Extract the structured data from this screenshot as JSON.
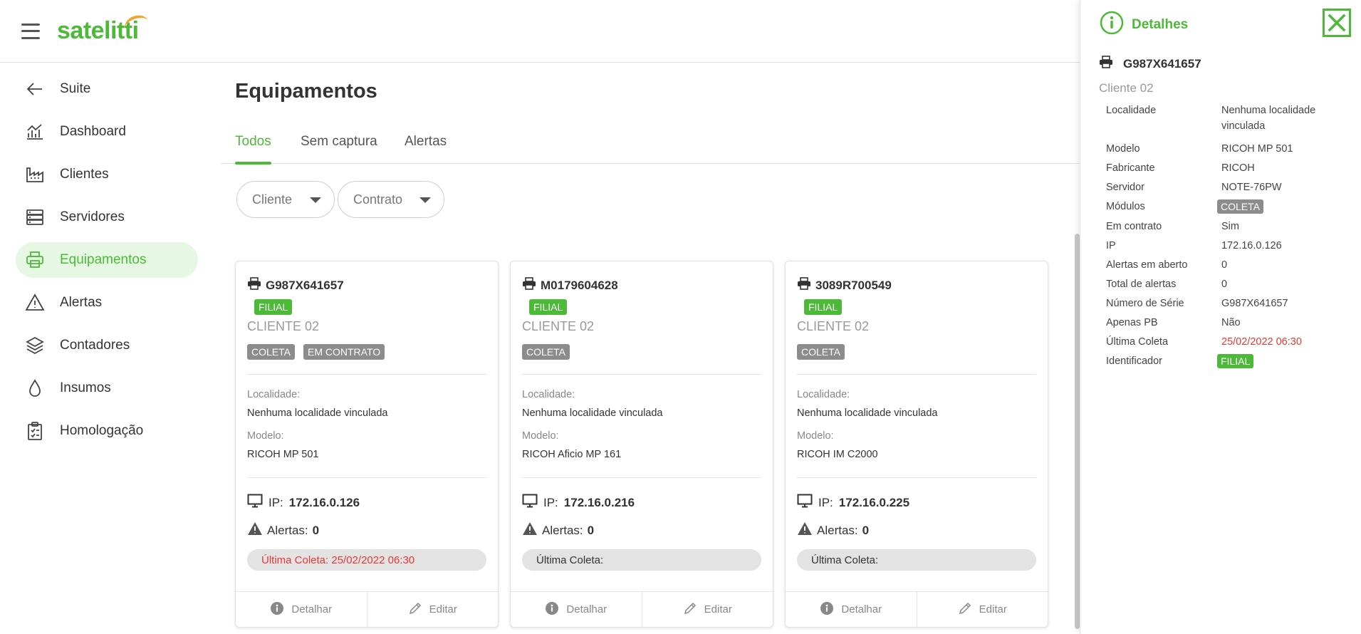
{
  "header": {
    "logo": "satelitti"
  },
  "sidebar": {
    "items": [
      {
        "label": "Suite",
        "icon": "arrow-left-icon",
        "active": false
      },
      {
        "label": "Dashboard",
        "icon": "chart-icon",
        "active": false
      },
      {
        "label": "Clientes",
        "icon": "factory-icon",
        "active": false
      },
      {
        "label": "Servidores",
        "icon": "server-icon",
        "active": false
      },
      {
        "label": "Equipamentos",
        "icon": "printer-icon",
        "active": true
      },
      {
        "label": "Alertas",
        "icon": "warning-icon",
        "active": false
      },
      {
        "label": "Contadores",
        "icon": "layers-icon",
        "active": false
      },
      {
        "label": "Insumos",
        "icon": "drop-icon",
        "active": false
      },
      {
        "label": "Homologação",
        "icon": "clipboard-icon",
        "active": false
      }
    ]
  },
  "main": {
    "title": "Equipamentos",
    "tabs": [
      {
        "label": "Todos",
        "active": true
      },
      {
        "label": "Sem captura",
        "active": false
      },
      {
        "label": "Alertas",
        "active": false
      }
    ],
    "filters": [
      {
        "label": "Cliente"
      },
      {
        "label": "Contrato"
      }
    ]
  },
  "cards": [
    {
      "serial": "G987X641657",
      "identifier": "FILIAL",
      "client": "CLIENTE 02",
      "tags": [
        "COLETA",
        "EM CONTRATO"
      ],
      "location_label": "Localidade:",
      "location": "Nenhuma localidade vinculada",
      "model_label": "Modelo:",
      "model": "RICOH MP 501",
      "ip_label": "IP:",
      "ip": "172.16.0.126",
      "alerts_label": "Alertas:",
      "alerts": "0",
      "last_capture": "Última Coleta: 25/02/2022 06:30",
      "last_capture_highlight": true,
      "detail_label": "Detalhar",
      "edit_label": "Editar"
    },
    {
      "serial": "M0179604628",
      "identifier": "FILIAL",
      "client": "CLIENTE 02",
      "tags": [
        "COLETA"
      ],
      "location_label": "Localidade:",
      "location": "Nenhuma localidade vinculada",
      "model_label": "Modelo:",
      "model": "RICOH Aficio MP 161",
      "ip_label": "IP:",
      "ip": "172.16.0.216",
      "alerts_label": "Alertas:",
      "alerts": "0",
      "last_capture": "Última Coleta:",
      "last_capture_highlight": false,
      "detail_label": "Detalhar",
      "edit_label": "Editar"
    },
    {
      "serial": "3089R700549",
      "identifier": "FILIAL",
      "client": "CLIENTE 02",
      "tags": [
        "COLETA"
      ],
      "location_label": "Localidade:",
      "location": "Nenhuma localidade vinculada",
      "model_label": "Modelo:",
      "model": "RICOH IM C2000",
      "ip_label": "IP:",
      "ip": "172.16.0.225",
      "alerts_label": "Alertas:",
      "alerts": "0",
      "last_capture": "Última Coleta:",
      "last_capture_highlight": false,
      "detail_label": "Detalhar",
      "edit_label": "Editar"
    }
  ],
  "panel": {
    "title": "Detalhes",
    "serial": "G987X641657",
    "client": "Cliente 02",
    "rows": [
      {
        "key": "Localidade",
        "value": "Nenhuma localidade vinculada",
        "type": "text"
      },
      {
        "key": "Modelo",
        "value": "RICOH MP 501",
        "type": "text"
      },
      {
        "key": "Fabricante",
        "value": "RICOH",
        "type": "text"
      },
      {
        "key": "Servidor",
        "value": "NOTE-76PW",
        "type": "text"
      },
      {
        "key": "Módulos",
        "value": "COLETA",
        "type": "badge-gray"
      },
      {
        "key": "Em contrato",
        "value": "Sim",
        "type": "text"
      },
      {
        "key": "IP",
        "value": "172.16.0.126",
        "type": "text"
      },
      {
        "key": "Alertas em aberto",
        "value": "0",
        "type": "text"
      },
      {
        "key": "Total de alertas",
        "value": "0",
        "type": "text"
      },
      {
        "key": "Número de Série",
        "value": "G987X641657",
        "type": "text"
      },
      {
        "key": "Apenas PB",
        "value": "Não",
        "type": "text"
      },
      {
        "key": "Última Coleta",
        "value": "25/02/2022 06:30",
        "type": "red"
      },
      {
        "key": "Identificador",
        "value": "FILIAL",
        "type": "badge-green"
      }
    ]
  },
  "colors": {
    "accent": "#4cba38",
    "alert": "#e53935",
    "badge_gray": "#8c8c8c"
  }
}
